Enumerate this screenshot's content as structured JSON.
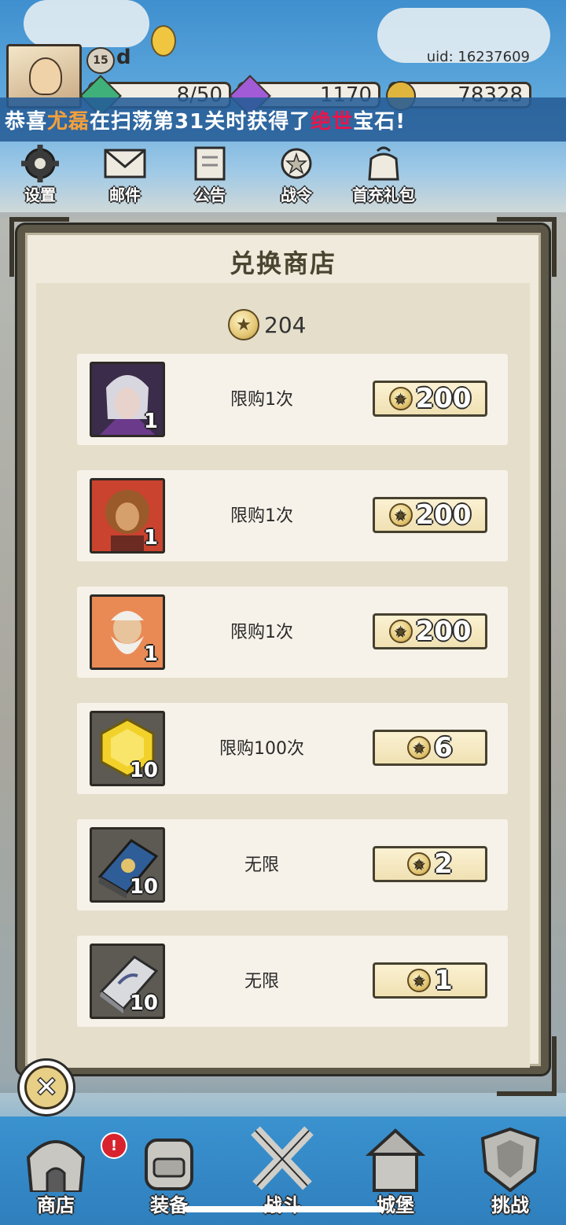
{
  "player": {
    "level": "15",
    "name": "d",
    "uid": "uid: 16237609",
    "resources": [
      {
        "name": "stamina",
        "value": "8/50",
        "color": "#3fb07a",
        "icon": "green-gem-icon"
      },
      {
        "name": "diamond",
        "value": "1170",
        "color": "#a25bd6",
        "icon": "purple-gem-icon"
      },
      {
        "name": "gold",
        "value": "78328",
        "color": "#e0b53d",
        "icon": "gold-coin-icon"
      }
    ]
  },
  "announcement": {
    "prefix": "恭喜",
    "player": "尤磊",
    "middle": "在扫荡第31关时获得了",
    "item": "绝世",
    "suffix": "宝石!"
  },
  "top_menu": [
    {
      "label": "设置",
      "icon": "gear-icon"
    },
    {
      "label": "邮件",
      "icon": "mail-icon"
    },
    {
      "label": "公告",
      "icon": "scroll-icon"
    },
    {
      "label": "战令",
      "icon": "battle-pass-icon"
    },
    {
      "label": "首充礼包",
      "icon": "gift-bag-icon"
    }
  ],
  "shop": {
    "title": "兑换商店",
    "balance": "204",
    "items": [
      {
        "icon": "hero-portrait-white-haired-woman-icon",
        "kind": "hero",
        "qty": "1",
        "limit": "限购1次",
        "price": "200"
      },
      {
        "icon": "hero-portrait-lion-warrior-icon",
        "kind": "hero",
        "qty": "1",
        "limit": "限购1次",
        "price": "200"
      },
      {
        "icon": "hero-portrait-old-sage-icon",
        "kind": "hero",
        "qty": "1",
        "limit": "限购1次",
        "price": "200"
      },
      {
        "icon": "yellow-hexagon-gem-icon",
        "kind": "prop",
        "qty": "10",
        "limit": "限购100次",
        "price": "6"
      },
      {
        "icon": "blue-tome-book-icon",
        "kind": "prop",
        "qty": "10",
        "limit": "无限",
        "price": "2"
      },
      {
        "icon": "silver-stone-tablet-icon",
        "kind": "prop",
        "qty": "10",
        "limit": "无限",
        "price": "1"
      }
    ]
  },
  "bottom_nav": [
    {
      "label": "商店",
      "icon": "shop-house-icon"
    },
    {
      "label": "装备",
      "icon": "backpack-icon"
    },
    {
      "label": "战斗",
      "icon": "crossed-swords-icon"
    },
    {
      "label": "城堡",
      "icon": "castle-icon"
    },
    {
      "label": "挑战",
      "icon": "shield-icon"
    }
  ],
  "alert_badge": "!"
}
